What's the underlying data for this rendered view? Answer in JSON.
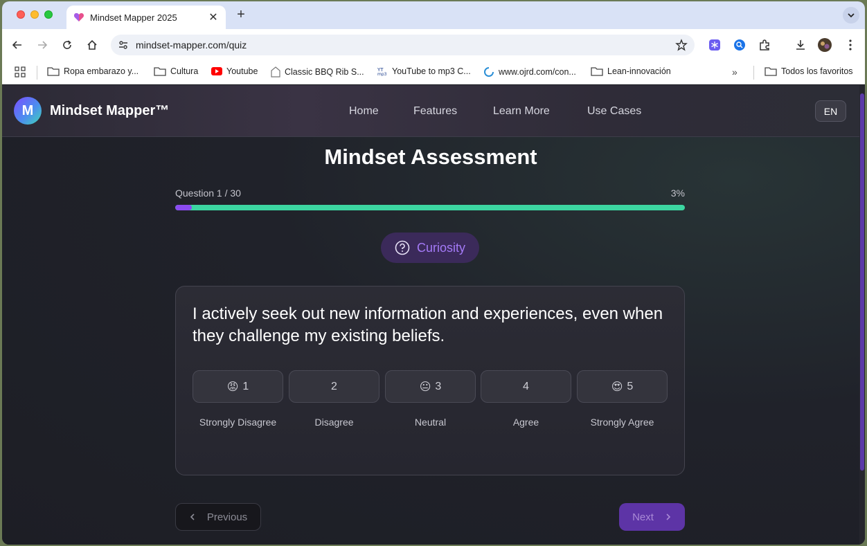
{
  "browser": {
    "tab_title": "Mindset Mapper 2025",
    "url": "mindset-mapper.com/quiz",
    "bookmarks": [
      {
        "label": "Ropa embarazo y...",
        "icon": "folder-icon"
      },
      {
        "label": "Cultura",
        "icon": "folder-icon"
      },
      {
        "label": "Youtube",
        "icon": "youtube-icon"
      },
      {
        "label": "Classic BBQ Rib S...",
        "icon": "site-icon"
      },
      {
        "label": "YouTube to mp3 C...",
        "icon": "yt-mp3-icon"
      },
      {
        "label": "www.ojrd.com/con...",
        "icon": "ojrd-icon"
      },
      {
        "label": "Lean-innovación",
        "icon": "folder-icon"
      }
    ],
    "all_bookmarks": "Todos los favoritos"
  },
  "nav": {
    "logo_letter": "M",
    "brand": "Mindset Mapper™",
    "links": [
      "Home",
      "Features",
      "Learn More",
      "Use Cases"
    ],
    "lang": "EN"
  },
  "quiz": {
    "title": "Mindset Assessment",
    "question_label": "Question 1 / 30",
    "percent_label": "3%",
    "progress_fraction": 0.033,
    "category": "Curiosity",
    "question": "I actively seek out new information and experiences, even when they challenge my existing beliefs.",
    "options": [
      {
        "value": "1",
        "emoji": "😡",
        "label": "Strongly Disagree"
      },
      {
        "value": "2",
        "emoji": "",
        "label": "Disagree"
      },
      {
        "value": "3",
        "emoji": "😐",
        "label": "Neutral"
      },
      {
        "value": "4",
        "emoji": "",
        "label": "Agree"
      },
      {
        "value": "5",
        "emoji": "😍",
        "label": "Strongly Agree"
      }
    ],
    "previous_label": "Previous",
    "next_label": "Next"
  },
  "colors": {
    "accent_purple": "#8b4bf0",
    "progress_track": "#3cd6a1",
    "category_text": "#a47af7"
  }
}
